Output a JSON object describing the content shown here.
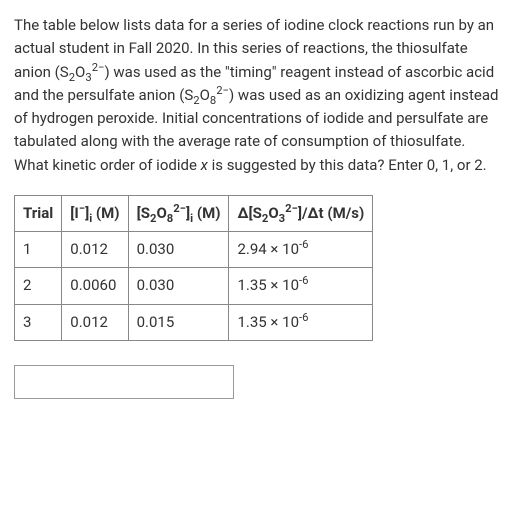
{
  "prompt": {
    "html": "The table below lists data for a series of iodine clock reactions run by an actual student in Fall 2020. In this series of reactions, the thiosulfate anion (S<sub>2</sub>O<sub>3</sub><sup>2−</sup>) was used as the \"timing\" reagent instead of ascorbic acid and the persulfate anion (S<sub>2</sub>O<sub>8</sub><sup>2−</sup>) was used as an oxidizing agent instead of hydrogen peroxide. Initial concentrations of iodide and persulfate are tabulated along with the average rate of consumption of thiosulfate. What kinetic order of iodide <i>x</i> is suggested by this data? Enter 0, 1, or 2."
  },
  "table": {
    "headers": {
      "trial": "Trial",
      "iodide_html": "[I<sup>−</sup>]<sub>i</sub> (M)",
      "persulfate_html": "[S<sub>2</sub>O<sub>8</sub><sup>2−</sup>]<sub>i</sub> (M)",
      "rate_html": "Δ[S<sub>2</sub>O<sub>3</sub><sup>2−</sup>]/Δt (M/s)"
    },
    "rows": [
      {
        "trial": "1",
        "iodide": "0.012",
        "persulfate": "0.030",
        "rate_html": "2.94 × 10<sup>-6</sup>"
      },
      {
        "trial": "2",
        "iodide": "0.0060",
        "persulfate": "0.030",
        "rate_html": "1.35 × 10<sup>-6</sup>"
      },
      {
        "trial": "3",
        "iodide": "0.012",
        "persulfate": "0.015",
        "rate_html": "1.35 × 10<sup>-6</sup>"
      }
    ]
  },
  "answer": {
    "value": ""
  }
}
